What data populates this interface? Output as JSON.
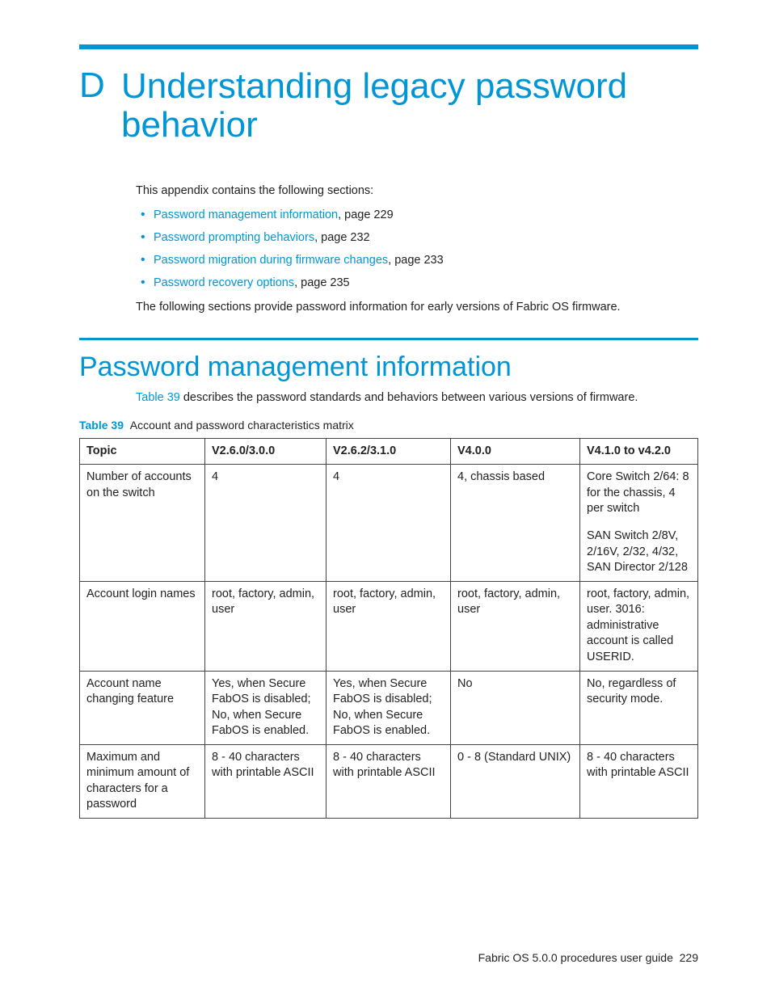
{
  "chapter": {
    "letter": "D",
    "title": "Understanding legacy password behavior"
  },
  "intro": {
    "lead": "This appendix contains the following sections:",
    "links": [
      {
        "label": "Password management information",
        "suffix": ", page 229"
      },
      {
        "label": "Password prompting behaviors",
        "suffix": ", page 232"
      },
      {
        "label": "Password migration during firmware changes",
        "suffix": ", page 233"
      },
      {
        "label": "Password recovery options",
        "suffix": ", page 235"
      }
    ],
    "followup": "The following sections provide password information for early versions of Fabric OS firmware."
  },
  "section": {
    "heading": "Password management information",
    "intro_link": "Table 39",
    "intro_rest": " describes the password standards and behaviors between various versions of firmware."
  },
  "table": {
    "label": "Table 39",
    "caption_rest": "Account and password characteristics matrix",
    "headers": [
      "Topic",
      "V2.6.0/3.0.0",
      "V2.6.2/3.1.0",
      "V4.0.0",
      "V4.1.0 to v4.2.0"
    ],
    "rows": [
      {
        "c0": "Number of accounts on the switch",
        "c1": "4",
        "c2": "4",
        "c3": "4, chassis based",
        "c4a": "Core Switch 2/64: 8 for the chassis, 4 per switch",
        "c4b": "SAN Switch 2/8V, 2/16V, 2/32, 4/32, SAN Director 2/128"
      },
      {
        "c0": "Account login names",
        "c1": "root, factory, admin, user",
        "c2": "root, factory, admin, user",
        "c3": "root, factory, admin, user",
        "c4a": "root, factory, admin, user. 3016: administrative account is called USERID.",
        "c4b": ""
      },
      {
        "c0": "Account name changing feature",
        "c1": "Yes, when Secure FabOS is disabled; No, when Secure FabOS is enabled.",
        "c2": "Yes, when Secure FabOS is disabled; No, when Secure FabOS is enabled.",
        "c3": "No",
        "c4a": "No, regardless of security mode.",
        "c4b": ""
      },
      {
        "c0": "Maximum and minimum amount of characters for a password",
        "c1": "8 - 40 characters with printable ASCII",
        "c2": "8 - 40 characters with printable ASCII",
        "c3": "0 - 8 (Standard UNIX)",
        "c4a": "8 - 40 characters with printable ASCII",
        "c4b": ""
      }
    ]
  },
  "footer": {
    "text": "Fabric OS 5.0.0 procedures user guide",
    "page": "229"
  }
}
